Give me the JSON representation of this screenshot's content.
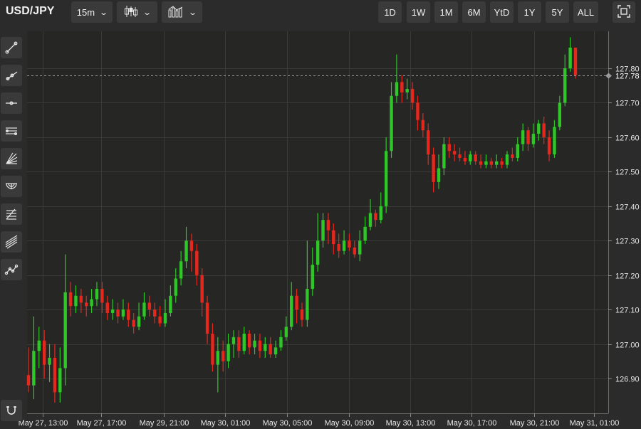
{
  "header": {
    "symbol": "USD/JPY",
    "interval": "15m",
    "chart_type_icon": "candlestick-icon",
    "indicators_icon": "indicators-icon",
    "ranges": [
      "1D",
      "1W",
      "1M",
      "6M",
      "YtD",
      "1Y",
      "5Y",
      "ALL"
    ],
    "fullscreen_icon": "fullscreen-icon"
  },
  "sidebar": {
    "tools": [
      "trend-line-icon",
      "ray-icon",
      "horizontal-line-icon",
      "parallel-channel-icon",
      "fan-icon",
      "arc-icon",
      "fibonacci-icon",
      "pitchfork-icon",
      "path-icon"
    ],
    "bottom_tool": "magnet-icon"
  },
  "colors": {
    "up": "#2ec727",
    "down": "#e8271c",
    "background": "#262624",
    "grid": "#3a3a38",
    "text": "#e6e6e6"
  },
  "chart_data": {
    "type": "candlestick",
    "title": "",
    "xlabel": "",
    "ylabel": "",
    "ylim": [
      126.82,
      127.91
    ],
    "y_ticks": [
      "127.80",
      "127.70",
      "127.60",
      "127.50",
      "127.40",
      "127.30",
      "127.20",
      "127.10",
      "127.00",
      "126.90"
    ],
    "x_ticks": [
      "May 27, 13:00",
      "May 27, 17:00",
      "May 29, 21:00",
      "May 30, 01:00",
      "May 30, 05:00",
      "May 30, 09:00",
      "May 30, 13:00",
      "May 30, 17:00",
      "May 30, 21:00",
      "May 31, 01:00"
    ],
    "last_price": "127.78",
    "grid": true,
    "candles": [
      [
        126.91,
        126.88,
        126.99,
        126.86
      ],
      [
        126.88,
        126.98,
        127.08,
        126.84
      ],
      [
        126.98,
        127.01,
        127.05,
        126.93
      ],
      [
        127.01,
        126.94,
        127.04,
        126.9
      ],
      [
        126.94,
        126.96,
        127.0,
        126.89
      ],
      [
        126.96,
        126.86,
        127.0,
        126.83
      ],
      [
        126.86,
        126.93,
        126.99,
        126.83
      ],
      [
        126.93,
        127.15,
        127.26,
        126.88
      ],
      [
        127.15,
        127.11,
        127.18,
        127.08
      ],
      [
        127.11,
        127.14,
        127.17,
        127.09
      ],
      [
        127.14,
        127.12,
        127.16,
        127.09
      ],
      [
        127.12,
        127.11,
        127.14,
        127.08
      ],
      [
        127.11,
        127.13,
        127.16,
        127.09
      ],
      [
        127.13,
        127.16,
        127.18,
        127.11
      ],
      [
        127.16,
        127.12,
        127.18,
        127.09
      ],
      [
        127.12,
        127.09,
        127.14,
        127.07
      ],
      [
        127.09,
        127.1,
        127.13,
        127.07
      ],
      [
        127.1,
        127.08,
        127.12,
        127.06
      ],
      [
        127.08,
        127.1,
        127.13,
        127.07
      ],
      [
        127.1,
        127.07,
        127.12,
        127.05
      ],
      [
        127.07,
        127.05,
        127.09,
        127.03
      ],
      [
        127.05,
        127.08,
        127.12,
        127.04
      ],
      [
        127.08,
        127.12,
        127.15,
        127.07
      ],
      [
        127.12,
        127.1,
        127.14,
        127.08
      ],
      [
        127.1,
        127.08,
        127.12,
        127.06
      ],
      [
        127.08,
        127.06,
        127.11,
        127.05
      ],
      [
        127.06,
        127.09,
        127.13,
        127.05
      ],
      [
        127.09,
        127.14,
        127.17,
        127.08
      ],
      [
        127.14,
        127.19,
        127.22,
        127.12
      ],
      [
        127.19,
        127.24,
        127.27,
        127.17
      ],
      [
        127.24,
        127.3,
        127.34,
        127.22
      ],
      [
        127.3,
        127.27,
        127.32,
        127.21
      ],
      [
        127.27,
        127.2,
        127.29,
        127.17
      ],
      [
        127.2,
        127.12,
        127.22,
        127.08
      ],
      [
        127.12,
        127.03,
        127.14,
        127.0
      ],
      [
        127.03,
        126.94,
        127.06,
        126.92
      ],
      [
        126.94,
        126.98,
        127.02,
        126.86
      ],
      [
        126.98,
        126.95,
        127.01,
        126.92
      ],
      [
        126.95,
        127.0,
        127.03,
        126.93
      ],
      [
        127.0,
        127.02,
        127.04,
        126.96
      ],
      [
        127.02,
        126.98,
        127.04,
        126.96
      ],
      [
        126.98,
        127.03,
        127.05,
        126.97
      ],
      [
        127.03,
        126.99,
        127.04,
        126.97
      ],
      [
        126.99,
        127.01,
        127.03,
        126.97
      ],
      [
        127.01,
        126.98,
        127.03,
        126.96
      ],
      [
        126.98,
        127.0,
        127.02,
        126.96
      ],
      [
        127.0,
        126.97,
        127.02,
        126.96
      ],
      [
        126.97,
        126.99,
        127.01,
        126.96
      ],
      [
        126.99,
        127.02,
        127.04,
        126.98
      ],
      [
        127.02,
        127.05,
        127.08,
        127.01
      ],
      [
        127.05,
        127.14,
        127.18,
        127.04
      ],
      [
        127.14,
        127.1,
        127.16,
        127.06
      ],
      [
        127.1,
        127.07,
        127.12,
        127.05
      ],
      [
        127.07,
        127.16,
        127.3,
        127.05
      ],
      [
        127.16,
        127.23,
        127.28,
        127.14
      ],
      [
        127.23,
        127.3,
        127.38,
        127.21
      ],
      [
        127.3,
        127.36,
        127.38,
        127.28
      ],
      [
        127.36,
        127.33,
        127.38,
        127.29
      ],
      [
        127.33,
        127.29,
        127.35,
        127.26
      ],
      [
        127.29,
        127.27,
        127.32,
        127.25
      ],
      [
        127.27,
        127.3,
        127.33,
        127.26
      ],
      [
        127.3,
        127.28,
        127.32,
        127.27
      ],
      [
        127.28,
        127.26,
        127.3,
        127.25
      ],
      [
        127.26,
        127.3,
        127.33,
        127.24
      ],
      [
        127.3,
        127.34,
        127.37,
        127.29
      ],
      [
        127.34,
        127.38,
        127.42,
        127.33
      ],
      [
        127.38,
        127.36,
        127.39,
        127.34
      ],
      [
        127.36,
        127.4,
        127.44,
        127.35
      ],
      [
        127.4,
        127.56,
        127.6,
        127.38
      ],
      [
        127.56,
        127.72,
        127.76,
        127.54
      ],
      [
        127.72,
        127.76,
        127.84,
        127.7
      ],
      [
        127.76,
        127.73,
        127.78,
        127.7
      ],
      [
        127.73,
        127.74,
        127.77,
        127.71
      ],
      [
        127.74,
        127.7,
        127.76,
        127.68
      ],
      [
        127.7,
        127.65,
        127.72,
        127.62
      ],
      [
        127.65,
        127.62,
        127.67,
        127.6
      ],
      [
        127.62,
        127.55,
        127.64,
        127.52
      ],
      [
        127.55,
        127.47,
        127.57,
        127.44
      ],
      [
        127.47,
        127.51,
        127.55,
        127.45
      ],
      [
        127.51,
        127.58,
        127.6,
        127.49
      ],
      [
        127.58,
        127.56,
        127.6,
        127.54
      ],
      [
        127.56,
        127.55,
        127.58,
        127.53
      ],
      [
        127.55,
        127.54,
        127.57,
        127.53
      ],
      [
        127.54,
        127.53,
        127.56,
        127.52
      ],
      [
        127.53,
        127.55,
        127.56,
        127.52
      ],
      [
        127.55,
        127.53,
        127.56,
        127.52
      ],
      [
        127.53,
        127.52,
        127.55,
        127.51
      ],
      [
        127.52,
        127.53,
        127.55,
        127.51
      ],
      [
        127.53,
        127.52,
        127.54,
        127.51
      ],
      [
        127.52,
        127.53,
        127.55,
        127.51
      ],
      [
        127.53,
        127.52,
        127.54,
        127.51
      ],
      [
        127.52,
        127.55,
        127.56,
        127.51
      ],
      [
        127.55,
        127.54,
        127.57,
        127.53
      ],
      [
        127.54,
        127.58,
        127.6,
        127.53
      ],
      [
        127.58,
        127.62,
        127.64,
        127.56
      ],
      [
        127.62,
        127.58,
        127.63,
        127.56
      ],
      [
        127.58,
        127.61,
        127.64,
        127.57
      ],
      [
        127.61,
        127.64,
        127.65,
        127.59
      ],
      [
        127.64,
        127.6,
        127.66,
        127.58
      ],
      [
        127.6,
        127.55,
        127.62,
        127.53
      ],
      [
        127.55,
        127.63,
        127.65,
        127.54
      ],
      [
        127.63,
        127.7,
        127.72,
        127.62
      ],
      [
        127.7,
        127.8,
        127.84,
        127.69
      ],
      [
        127.8,
        127.86,
        127.89,
        127.79
      ],
      [
        127.86,
        127.78,
        127.86,
        127.77
      ]
    ]
  }
}
